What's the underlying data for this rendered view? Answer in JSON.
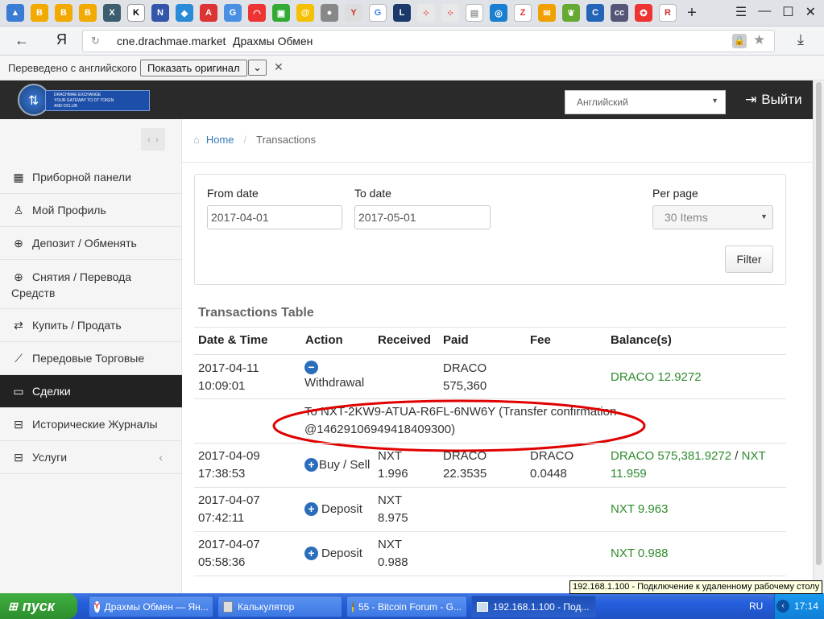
{
  "browser": {
    "url": "cne.drachmae.market",
    "page_title": "Драхмы Обмен",
    "translate_text": "Переведено с английского",
    "show_original": "Показать оригинал"
  },
  "header": {
    "logo_line1": "DRACHMAE EXCHANGE",
    "logo_line2": "YOUR GATEWAY TO DT TOKEN",
    "logo_line3": "AND DCLUB",
    "language": "Английский",
    "logout": "Выйти"
  },
  "breadcrumb": {
    "home": "Home",
    "sep": "/",
    "current": "Transactions"
  },
  "sidebar": {
    "items": [
      {
        "label": "Приборной панели",
        "icon": "grid-icon"
      },
      {
        "label": "Мой Профиль",
        "icon": "user-icon"
      },
      {
        "label": "Депозит / Обменять",
        "icon": "circle-down-icon"
      },
      {
        "label": "Снятия / Перевода Средств",
        "icon": "circle-up-icon"
      },
      {
        "label": "Купить / Продать",
        "icon": "exchange-icon"
      },
      {
        "label": "Передовые Торговые",
        "icon": "chart-icon"
      },
      {
        "label": "Сделки",
        "icon": "wallet-icon"
      },
      {
        "label": "Исторические Журналы",
        "icon": "inbox-icon"
      },
      {
        "label": "Услуги",
        "icon": "inbox-icon"
      }
    ]
  },
  "filter": {
    "from_label": "From date",
    "from_value": "2017-04-01",
    "to_label": "To date",
    "to_value": "2017-05-01",
    "per_page_label": "Per page",
    "per_page_value": "30 Items",
    "filter_button": "Filter"
  },
  "table": {
    "title": "Transactions Table",
    "headers": [
      "Date & Time",
      "Action",
      "Received",
      "Paid",
      "Fee",
      "Balance(s)"
    ],
    "rows": [
      {
        "date": "2017-04-11",
        "time": "10:09:01",
        "action": "Withdrawal",
        "received": "",
        "paid1": "DRACO",
        "paid2": "575,360",
        "fee1": "",
        "fee2": "",
        "balance": "DRACO 12.9272",
        "balance2": ""
      },
      {
        "date": "2017-04-09",
        "time": "17:38:53",
        "action": "Buy / Sell",
        "received": "NXT",
        "received2": "1.996",
        "paid1": "DRACO",
        "paid2": "22.3535",
        "fee1": "DRACO",
        "fee2": "0.0448",
        "balance": "DRACO 575,381.9272",
        "balance_sep": "/",
        "balance_nxt": "NXT",
        "balance2": "11.959"
      },
      {
        "date": "2017-04-07",
        "time": "07:42:11",
        "action": "Deposit",
        "received": "NXT",
        "received2": "8.975",
        "balance": "NXT 9.963"
      },
      {
        "date": "2017-04-07",
        "time": "05:58:36",
        "action": "Deposit",
        "received": "NXT",
        "received2": "0.988",
        "balance": "NXT 0.988"
      }
    ],
    "detail_line1": "To NXT-2KW9-ATUA-R6FL-6NW6Y (Transfer confirmation",
    "detail_line2": "@14629106949418409300)"
  },
  "taskbar": {
    "start": "пуск",
    "tasks": [
      "Драхмы Обмен — Ян...",
      "Калькулятор",
      "55 - Bitcoin Forum - G...",
      "192.168.1.100 - Под..."
    ],
    "lang": "RU",
    "clock": "17:14",
    "tooltip": "192.168.1.100 - Подключение к удаленному рабочему столу"
  },
  "colors": {
    "accent_green": "#2e8b2e",
    "link_blue": "#337ab7",
    "annotation_red": "#e00000"
  }
}
